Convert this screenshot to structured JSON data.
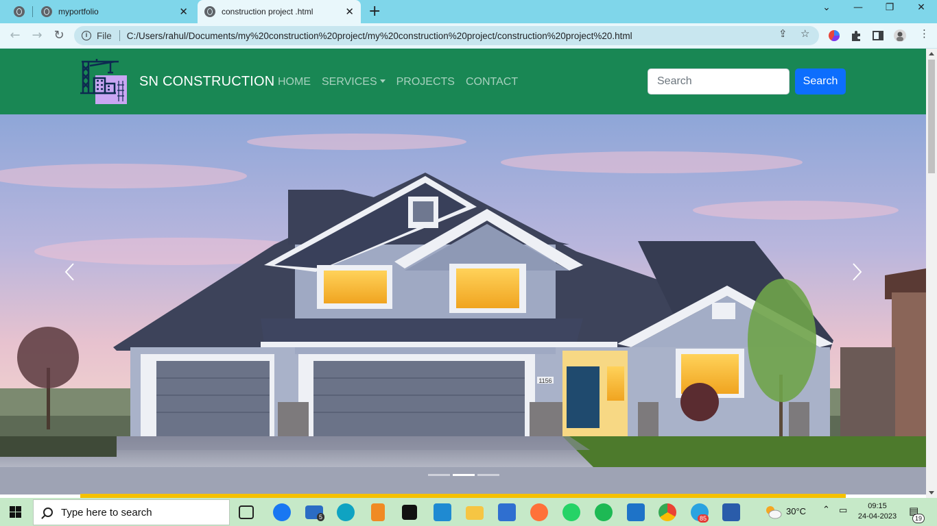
{
  "browser": {
    "tabs": [
      {
        "title": "myportfolio",
        "active": false
      },
      {
        "title": "construction project .html",
        "active": true
      }
    ],
    "address": {
      "scheme_label": "File",
      "url": "C:/Users/rahul/Documents/my%20construction%20project/my%20construction%20project/construction%20project%20.html"
    }
  },
  "site": {
    "brand": "SN CONSTRUCTION",
    "nav": {
      "home": "HOME",
      "services": "SERVICES",
      "projects": "PROJECTS",
      "contact": "CONTACT"
    },
    "search": {
      "placeholder": "Search",
      "button_label": "Search"
    },
    "brand_color": "#198754",
    "button_color": "#0d6efd",
    "accent_bar_color": "#f5c100",
    "carousel": {
      "slides": 3,
      "active_slide": 2,
      "image": "suburban-house-photo",
      "house_number": "1156"
    }
  },
  "taskbar": {
    "search_placeholder": "Type here to search",
    "apps": [
      "task-view",
      "facebook",
      "mail",
      "edge",
      "media-player",
      "terminal",
      "vscode",
      "file-explorer",
      "store",
      "firefox",
      "whatsapp",
      "spotify",
      "remote-desktop",
      "chrome",
      "telegram",
      "photos"
    ],
    "mail_badge": "5",
    "telegram_badge": "85",
    "weather": "30°C",
    "time": "09:15",
    "date": "24-04-2023",
    "notifications": "19"
  }
}
